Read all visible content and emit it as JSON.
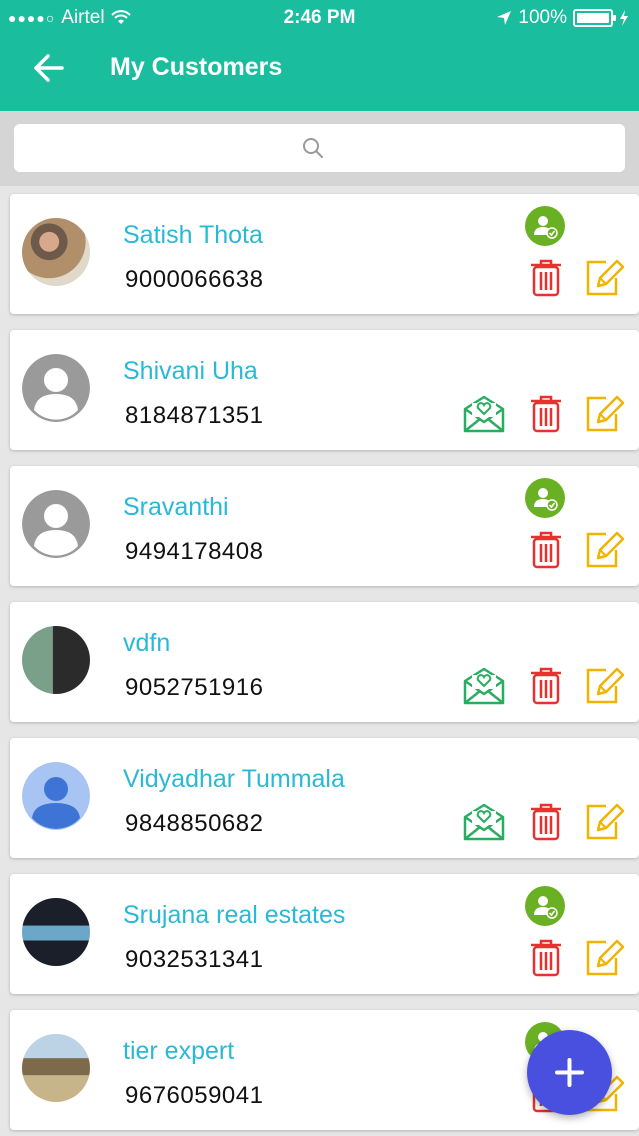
{
  "status_bar": {
    "carrier": "Airtel",
    "time": "2:46 PM",
    "battery": "100%"
  },
  "header": {
    "title": "My Customers"
  },
  "colors": {
    "primary": "#1bbd9f",
    "name": "#29b9d6",
    "delete": "#e8312f",
    "edit": "#f0b400",
    "invite": "#27ae60",
    "verified": "#6ab023",
    "fab": "#4950e0"
  },
  "customers": [
    {
      "name": "Satish Thota",
      "phone": "9000066638",
      "avatar": "photo",
      "status": "verified"
    },
    {
      "name": "Shivani Uha",
      "phone": "8184871351",
      "avatar": "default-gray",
      "status": "invite"
    },
    {
      "name": "Sravanthi",
      "phone": "9494178408",
      "avatar": "default-gray",
      "status": "verified"
    },
    {
      "name": "vdfn",
      "phone": "9052751916",
      "avatar": "photo",
      "status": "invite"
    },
    {
      "name": "Vidyadhar Tummala",
      "phone": "9848850682",
      "avatar": "default-blue",
      "status": "invite"
    },
    {
      "name": "Srujana real estates",
      "phone": "9032531341",
      "avatar": "photo",
      "status": "verified"
    },
    {
      "name": "tier expert",
      "phone": "9676059041",
      "avatar": "photo",
      "status": "verified"
    }
  ],
  "icons": {
    "back": "arrow-left-icon",
    "search": "search-icon",
    "add": "plus-icon",
    "verified": "user-check-icon",
    "invite": "envelope-heart-icon",
    "delete": "trash-icon",
    "edit": "edit-icon"
  }
}
